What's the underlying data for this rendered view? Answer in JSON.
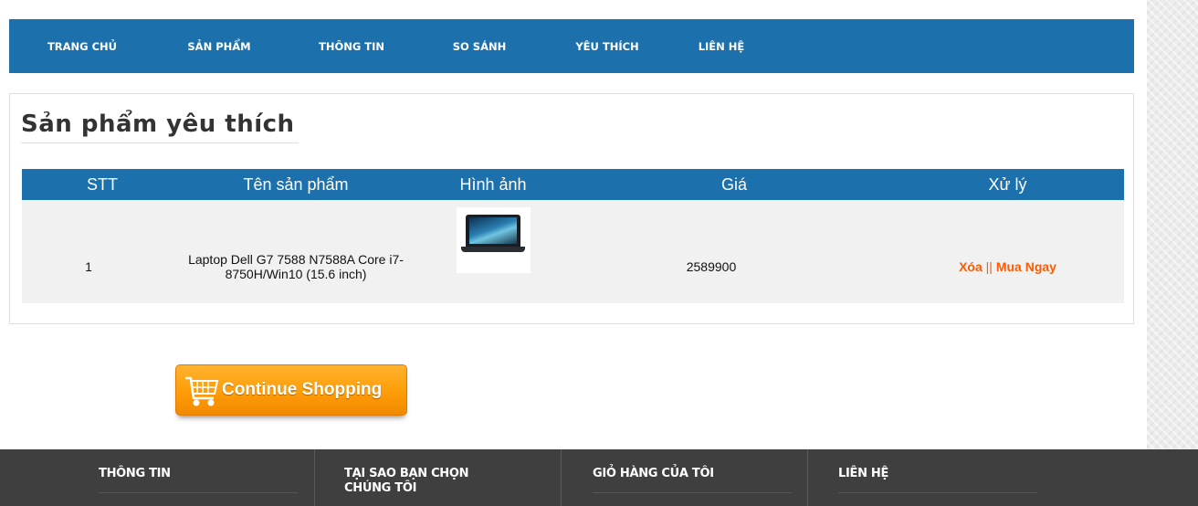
{
  "nav": {
    "items": [
      {
        "label": "TRANG CHỦ"
      },
      {
        "label": "SẢN PHẨM"
      },
      {
        "label": "THÔNG TIN"
      },
      {
        "label": "SO SÁNH"
      },
      {
        "label": "YÊU THÍCH"
      },
      {
        "label": "LIÊN HỆ"
      }
    ]
  },
  "favorites": {
    "title": "Sản phẩm yêu thích",
    "columns": [
      "STT",
      "Tên sản phẩm",
      "Hình ảnh",
      "Giá",
      "Xử lý"
    ],
    "rows": [
      {
        "stt": "1",
        "name": "Laptop Dell G7 7588 N7588A Core i7-8750H/Win10 (15.6 inch)",
        "image_icon": "laptop-image",
        "price": "2589900",
        "delete_label": "Xóa",
        "separator": "||",
        "buy_label": "Mua Ngay"
      }
    ]
  },
  "continue_button": {
    "label": "Continue Shopping",
    "icon": "shopping-cart-icon"
  },
  "footer": {
    "headings": [
      "THÔNG TIN",
      "TẠI SAO BẠN CHỌN CHÚNG TÔI",
      "GIỎ HÀNG CỦA TÔI",
      "LIÊN HỆ"
    ]
  },
  "colors": {
    "primary": "#1c71ac",
    "accent": "#ff5a00",
    "footer_bg": "#3f3f3f"
  }
}
